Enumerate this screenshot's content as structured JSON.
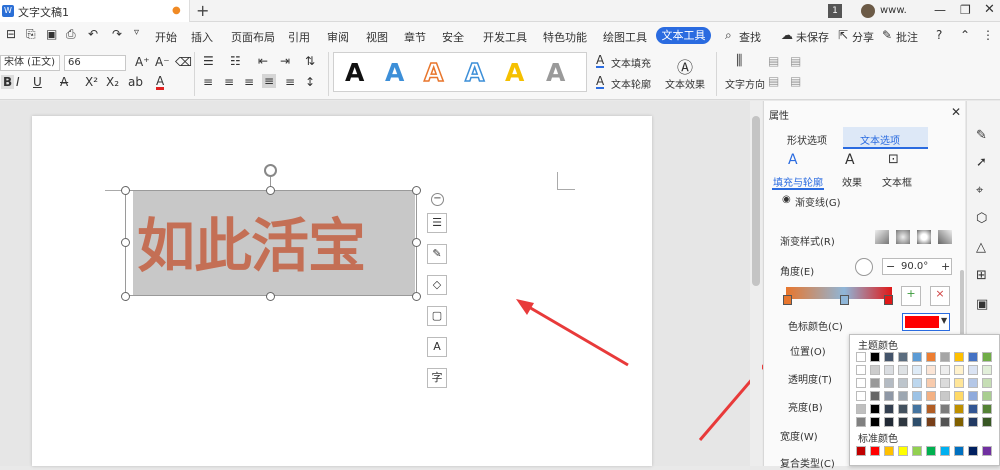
{
  "titlebar": {
    "doc_tab": "文字文稿1",
    "new_tab": "+",
    "page_num": "1",
    "user": "www.",
    "tab_dot": "●",
    "doc_icon": "W"
  },
  "menus": [
    "开始",
    "插入",
    "页面布局",
    "引用",
    "审阅",
    "视图",
    "章节",
    "安全",
    "开发工具",
    "特色功能",
    "绘图工具"
  ],
  "active_menu": "文本工具",
  "right_menu": {
    "search": "查找",
    "unsaved": "未保存",
    "share": "分享",
    "comment": "批注",
    "help": "?"
  },
  "ribbon": {
    "font_name": "宋体 (正文)",
    "font_size": "66",
    "format_marks": [
      "B",
      "I",
      "U",
      "A",
      "X²",
      "X₂",
      "ab",
      "A"
    ],
    "fill_label": "文本填充",
    "outline_label": "文本轮廓",
    "effect_label": "文本效果",
    "direction_label": "文字方向",
    "style_colors": [
      "#111111",
      "#3d8fd8",
      "#e8762d",
      "#3d8fd8",
      "#f5c000",
      "#9a9a9a"
    ]
  },
  "document": {
    "textbox_text": "如此活宝"
  },
  "panel": {
    "title": "属性",
    "tab_shape": "形状选项",
    "tab_text": "文本选项",
    "sub_fill": "填充与轮廓",
    "sub_effect": "效果",
    "sub_textbox": "文本框",
    "gradient_line": "渐变线(G)",
    "gradient_style": "渐变样式(R)",
    "angle_label": "角度(E)",
    "angle_value": "90.0°",
    "stop_color": "色标颜色(C)",
    "position": "位置(O)",
    "transparency": "透明度(T)",
    "brightness": "亮度(B)",
    "width": "宽度(W)",
    "compound": "复合类型(C)"
  },
  "palette": {
    "theme_title": "主题颜色",
    "standard_title": "标准颜色",
    "theme_top": [
      "#ffffff",
      "#000000",
      "#44546a",
      "#5b6d7f",
      "#5b9bd5",
      "#ed7d31",
      "#a5a5a5",
      "#ffc000",
      "#4472c4",
      "#70ad47"
    ],
    "standard": [
      "#c00000",
      "#ff0000",
      "#ffc000",
      "#ffff00",
      "#92d050",
      "#00b050",
      "#00b0f0",
      "#0070c0",
      "#002060",
      "#7030a0"
    ]
  },
  "stop_color_value": "#ff0000"
}
